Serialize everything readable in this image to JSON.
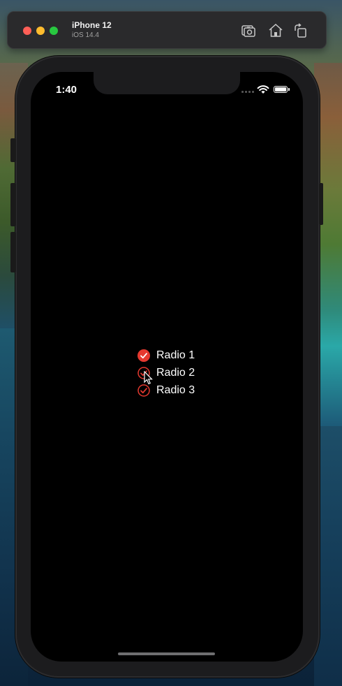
{
  "window": {
    "device_name": "iPhone 12",
    "os_version": "iOS 14.4",
    "toolbar": {
      "screenshot_icon": "camera-icon",
      "home_icon": "home-icon",
      "rotate_icon": "rotate-icon"
    }
  },
  "status_bar": {
    "time": "1:40",
    "wifi_icon": "wifi-icon",
    "battery_icon": "battery-icon"
  },
  "radio_group": {
    "accent_color": "#e5392f",
    "items": [
      {
        "label": "Radio 1",
        "selected": true
      },
      {
        "label": "Radio 2",
        "selected": false
      },
      {
        "label": "Radio 3",
        "selected": false
      }
    ]
  }
}
